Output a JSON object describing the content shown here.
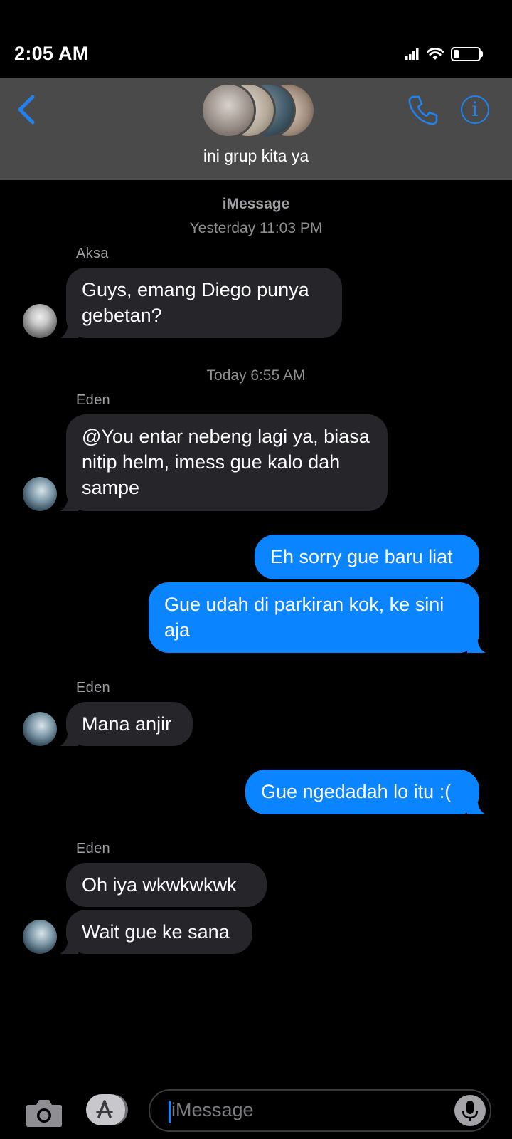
{
  "status_bar": {
    "time": "2:05 AM"
  },
  "header": {
    "group_name": "ini grup kita ya"
  },
  "thread": {
    "service": "iMessage",
    "stamp_1": "Yesterday 11:03 PM",
    "stamp_2": "Today 6:55 AM",
    "messages": [
      {
        "sender": "Aksa",
        "text": "Guys, emang Diego punya gebetan?"
      },
      {
        "sender": "Eden",
        "text": "@You entar nebeng lagi ya, biasa nitip helm, imess gue kalo dah sampe"
      },
      {
        "sender": "",
        "text": "Eh sorry gue baru liat"
      },
      {
        "sender": "",
        "text": "Gue udah di parkiran kok, ke sini aja"
      },
      {
        "sender": "Eden",
        "text": "Mana anjir"
      },
      {
        "sender": "",
        "text": "Gue ngedadah lo itu :("
      },
      {
        "sender": "Eden",
        "text": "Oh iya wkwkwkwk"
      },
      {
        "sender": "",
        "text": "Wait gue ke sana"
      }
    ]
  },
  "composer": {
    "placeholder": "iMessage"
  },
  "icons": [
    "signal-icon",
    "wifi-icon",
    "battery-icon",
    "back-chevron-icon",
    "phone-icon",
    "info-icon",
    "camera-icon",
    "app-store-icon",
    "microphone-icon"
  ],
  "colors": {
    "accent": "#0a84ff",
    "header_bg": "#4a4a4a",
    "incoming_bubble": "#26252a",
    "background": "#000000"
  }
}
